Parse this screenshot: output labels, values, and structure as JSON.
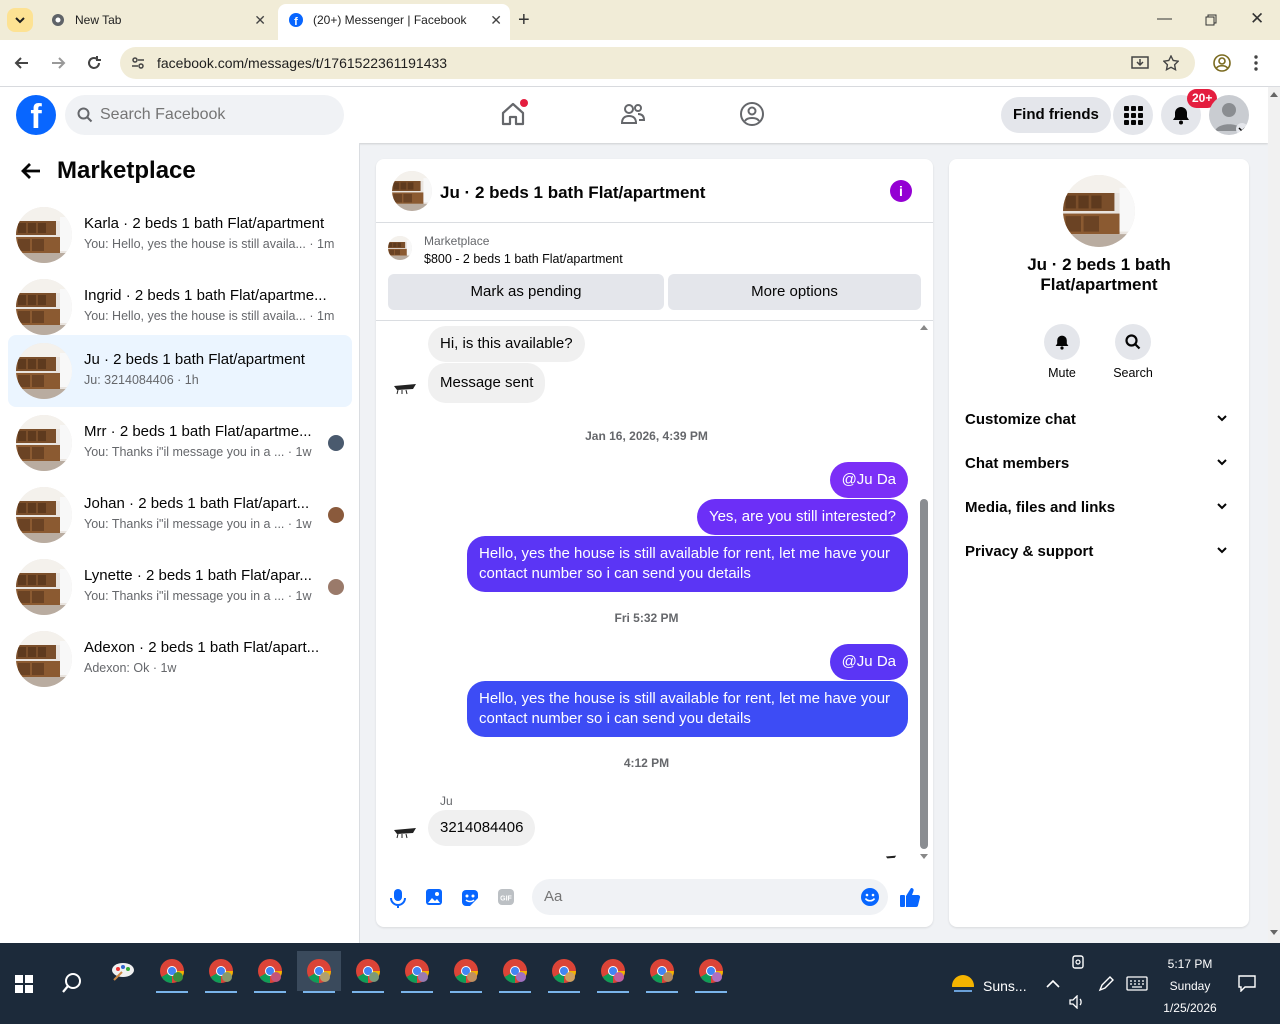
{
  "browser": {
    "tabs": [
      {
        "title": "New Tab"
      },
      {
        "title": "(20+) Messenger | Facebook"
      }
    ],
    "url": "facebook.com/messages/t/1761522361191433"
  },
  "header": {
    "search_placeholder": "Search Facebook",
    "find_friends": "Find friends",
    "notification_badge": "20+",
    "brand_color": "#0866ff"
  },
  "sidebar": {
    "title": "Marketplace",
    "conversations": [
      {
        "name": "Karla · 2 beds 1 bath Flat/apartment",
        "preview": "You: Hello, yes the house is still availa...",
        "time": "· 1m"
      },
      {
        "name": "Ingrid · 2 beds 1 bath Flat/apartme...",
        "preview": "You: Hello, yes the house is still availa...",
        "time": "· 1m"
      },
      {
        "name": "Ju · 2 beds 1 bath Flat/apartment",
        "preview": "Ju: 3214084406",
        "time": "· 1h"
      },
      {
        "name": "Mrr · 2 beds 1 bath Flat/apartme...",
        "preview": "You: Thanks i\"il message you in a ...",
        "time": "· 1w"
      },
      {
        "name": "Johan · 2 beds 1 bath Flat/apart...",
        "preview": "You: Thanks i\"il message you in a ...",
        "time": "· 1w"
      },
      {
        "name": "Lynette · 2 beds 1 bath Flat/apar...",
        "preview": "You: Thanks i\"il message you in a ...",
        "time": "· 1w"
      },
      {
        "name": "Adexon · 2 beds 1 bath Flat/apart...",
        "preview": "Adexon: Ok",
        "time": "· 1w"
      }
    ]
  },
  "chat": {
    "title": "Ju · 2 beds 1 bath Flat/apartment",
    "marketplace_label": "Marketplace",
    "listing": "$800 - 2 beds 1 bath Flat/apartment",
    "mark_pending": "Mark as pending",
    "more_options": "More options",
    "messages": {
      "m1": "Hi, is this available?",
      "m2": "Message sent",
      "ts1": "Jan 16, 2026, 4:39 PM",
      "m3": "@Ju Da",
      "m4": "Yes, are you still interested?",
      "m5": "Hello, yes the house is still available for rent, let me have your contact number so i can send you details",
      "ts2": "Fri 5:32 PM",
      "m6": "@Ju Da",
      "m7": "Hello, yes the house is still available for rent, let me have your contact number so i can send you details",
      "ts3": "4:12 PM",
      "sender": "Ju",
      "m8": "3214084406"
    },
    "composer_placeholder": "Aa"
  },
  "details": {
    "name": "Ju · 2 beds 1 bath Flat/apartment",
    "mute": "Mute",
    "search": "Search",
    "sections": [
      "Customize chat",
      "Chat members",
      "Media, files and links",
      "Privacy & support"
    ]
  },
  "taskbar": {
    "weather": "Suns...",
    "time": "5:17 PM",
    "day": "Sunday",
    "date": "1/25/2026"
  }
}
